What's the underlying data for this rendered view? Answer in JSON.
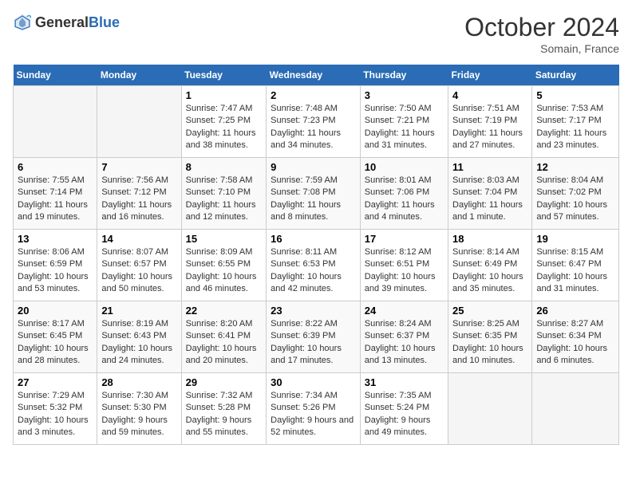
{
  "header": {
    "logo_general": "General",
    "logo_blue": "Blue",
    "month_title": "October 2024",
    "subtitle": "Somain, France"
  },
  "weekdays": [
    "Sunday",
    "Monday",
    "Tuesday",
    "Wednesday",
    "Thursday",
    "Friday",
    "Saturday"
  ],
  "weeks": [
    [
      {
        "day": "",
        "empty": true
      },
      {
        "day": "",
        "empty": true
      },
      {
        "day": "1",
        "sunrise": "7:47 AM",
        "sunset": "7:25 PM",
        "daylight": "11 hours and 38 minutes."
      },
      {
        "day": "2",
        "sunrise": "7:48 AM",
        "sunset": "7:23 PM",
        "daylight": "11 hours and 34 minutes."
      },
      {
        "day": "3",
        "sunrise": "7:50 AM",
        "sunset": "7:21 PM",
        "daylight": "11 hours and 31 minutes."
      },
      {
        "day": "4",
        "sunrise": "7:51 AM",
        "sunset": "7:19 PM",
        "daylight": "11 hours and 27 minutes."
      },
      {
        "day": "5",
        "sunrise": "7:53 AM",
        "sunset": "7:17 PM",
        "daylight": "11 hours and 23 minutes."
      }
    ],
    [
      {
        "day": "6",
        "sunrise": "7:55 AM",
        "sunset": "7:14 PM",
        "daylight": "11 hours and 19 minutes."
      },
      {
        "day": "7",
        "sunrise": "7:56 AM",
        "sunset": "7:12 PM",
        "daylight": "11 hours and 16 minutes."
      },
      {
        "day": "8",
        "sunrise": "7:58 AM",
        "sunset": "7:10 PM",
        "daylight": "11 hours and 12 minutes."
      },
      {
        "day": "9",
        "sunrise": "7:59 AM",
        "sunset": "7:08 PM",
        "daylight": "11 hours and 8 minutes."
      },
      {
        "day": "10",
        "sunrise": "8:01 AM",
        "sunset": "7:06 PM",
        "daylight": "11 hours and 4 minutes."
      },
      {
        "day": "11",
        "sunrise": "8:03 AM",
        "sunset": "7:04 PM",
        "daylight": "11 hours and 1 minute."
      },
      {
        "day": "12",
        "sunrise": "8:04 AM",
        "sunset": "7:02 PM",
        "daylight": "10 hours and 57 minutes."
      }
    ],
    [
      {
        "day": "13",
        "sunrise": "8:06 AM",
        "sunset": "6:59 PM",
        "daylight": "10 hours and 53 minutes."
      },
      {
        "day": "14",
        "sunrise": "8:07 AM",
        "sunset": "6:57 PM",
        "daylight": "10 hours and 50 minutes."
      },
      {
        "day": "15",
        "sunrise": "8:09 AM",
        "sunset": "6:55 PM",
        "daylight": "10 hours and 46 minutes."
      },
      {
        "day": "16",
        "sunrise": "8:11 AM",
        "sunset": "6:53 PM",
        "daylight": "10 hours and 42 minutes."
      },
      {
        "day": "17",
        "sunrise": "8:12 AM",
        "sunset": "6:51 PM",
        "daylight": "10 hours and 39 minutes."
      },
      {
        "day": "18",
        "sunrise": "8:14 AM",
        "sunset": "6:49 PM",
        "daylight": "10 hours and 35 minutes."
      },
      {
        "day": "19",
        "sunrise": "8:15 AM",
        "sunset": "6:47 PM",
        "daylight": "10 hours and 31 minutes."
      }
    ],
    [
      {
        "day": "20",
        "sunrise": "8:17 AM",
        "sunset": "6:45 PM",
        "daylight": "10 hours and 28 minutes."
      },
      {
        "day": "21",
        "sunrise": "8:19 AM",
        "sunset": "6:43 PM",
        "daylight": "10 hours and 24 minutes."
      },
      {
        "day": "22",
        "sunrise": "8:20 AM",
        "sunset": "6:41 PM",
        "daylight": "10 hours and 20 minutes."
      },
      {
        "day": "23",
        "sunrise": "8:22 AM",
        "sunset": "6:39 PM",
        "daylight": "10 hours and 17 minutes."
      },
      {
        "day": "24",
        "sunrise": "8:24 AM",
        "sunset": "6:37 PM",
        "daylight": "10 hours and 13 minutes."
      },
      {
        "day": "25",
        "sunrise": "8:25 AM",
        "sunset": "6:35 PM",
        "daylight": "10 hours and 10 minutes."
      },
      {
        "day": "26",
        "sunrise": "8:27 AM",
        "sunset": "6:34 PM",
        "daylight": "10 hours and 6 minutes."
      }
    ],
    [
      {
        "day": "27",
        "sunrise": "7:29 AM",
        "sunset": "5:32 PM",
        "daylight": "10 hours and 3 minutes."
      },
      {
        "day": "28",
        "sunrise": "7:30 AM",
        "sunset": "5:30 PM",
        "daylight": "9 hours and 59 minutes."
      },
      {
        "day": "29",
        "sunrise": "7:32 AM",
        "sunset": "5:28 PM",
        "daylight": "9 hours and 55 minutes."
      },
      {
        "day": "30",
        "sunrise": "7:34 AM",
        "sunset": "5:26 PM",
        "daylight": "9 hours and 52 minutes."
      },
      {
        "day": "31",
        "sunrise": "7:35 AM",
        "sunset": "5:24 PM",
        "daylight": "9 hours and 49 minutes."
      },
      {
        "day": "",
        "empty": true
      },
      {
        "day": "",
        "empty": true
      }
    ]
  ]
}
